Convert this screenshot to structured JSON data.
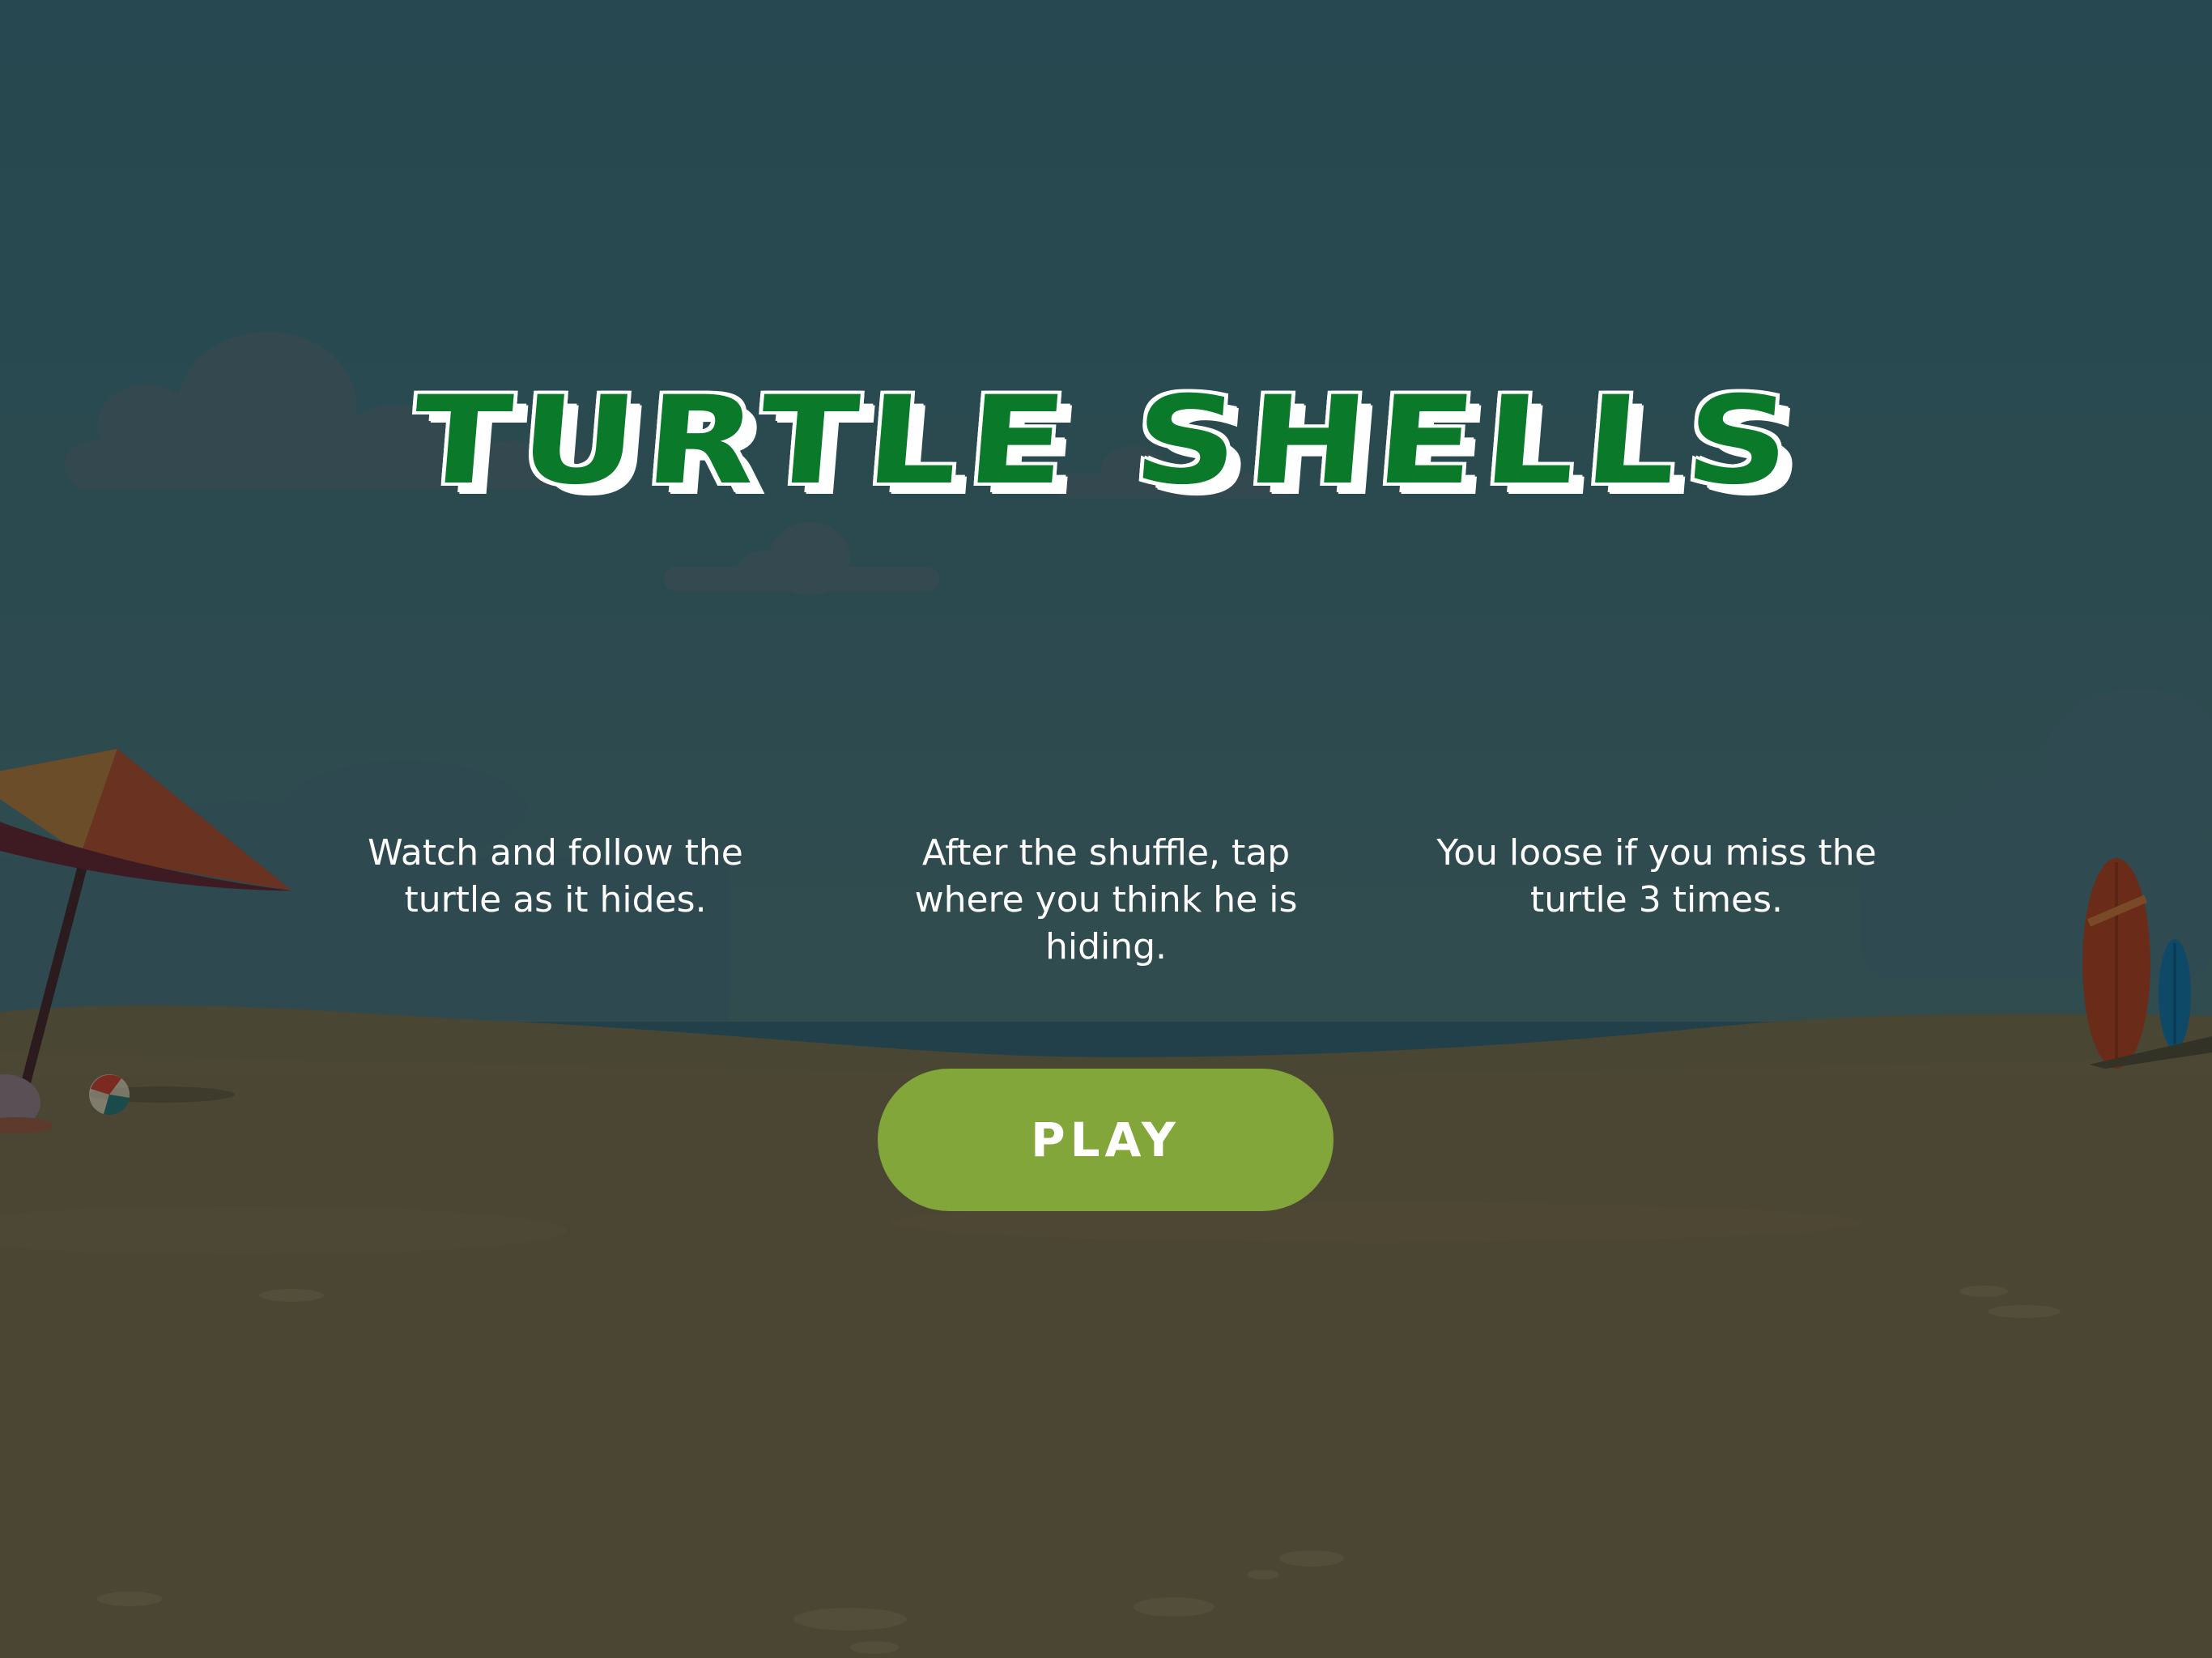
{
  "game": {
    "title": "TURTLE SHELLS"
  },
  "instructions": [
    {
      "text": "Watch and follow the turtle as it hides."
    },
    {
      "text": "After the shuffle, tap where you think he is hiding."
    },
    {
      "text": "You loose if you miss the turtle 3 times."
    }
  ],
  "play_button": {
    "label": "PLAY"
  },
  "colors": {
    "sky": "#24424a",
    "sand": "#4b4634",
    "title_green": "#0a7a2a",
    "button_green": "#82a63a",
    "text": "#ffffff"
  }
}
